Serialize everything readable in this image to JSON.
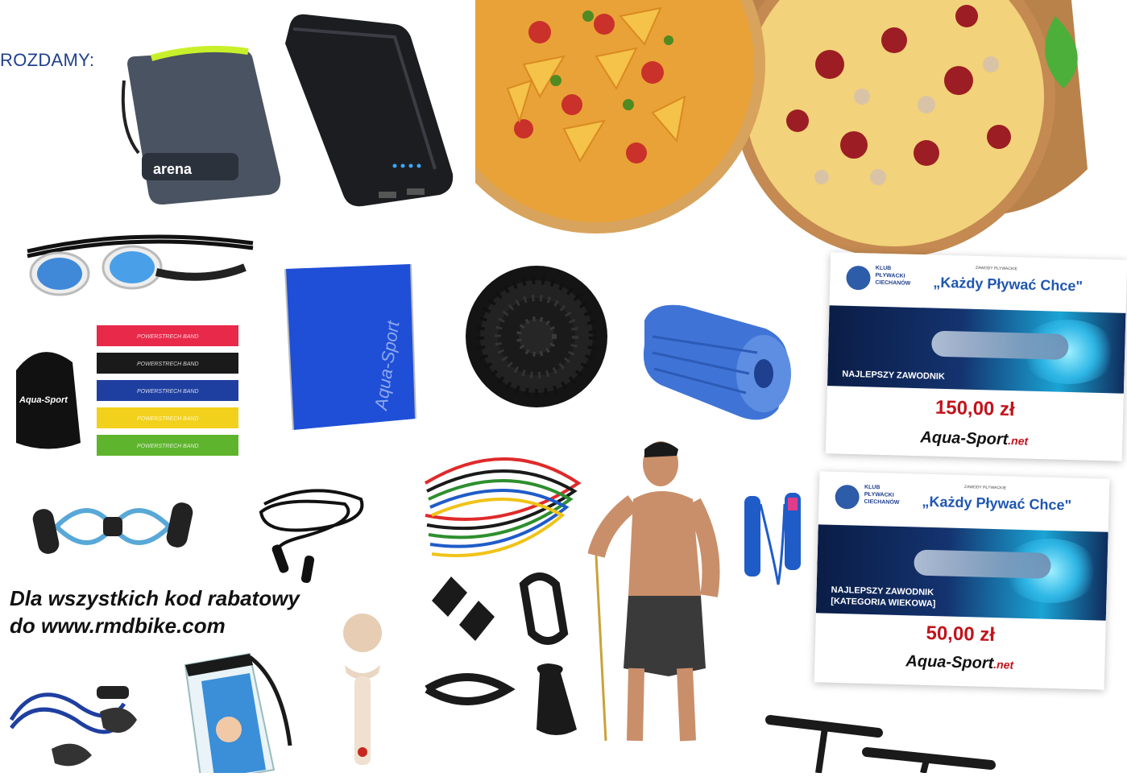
{
  "heading": "ROZDAMY:",
  "promo": {
    "line1": "Dla wszystkich kod rabatowy",
    "line2": "do www.rmdbike.com"
  },
  "prize_cards": [
    {
      "club": "KLUB\nPŁYWACKI\nCIECHANÓW",
      "event_small": "ZAWODY PŁYWACKIE",
      "event_title": "„Każdy Pływać Chce\"",
      "category": "NAJLEPSZY ZAWODNIK",
      "amount": "150,00 zł",
      "brand": "Aqua-Sport",
      "brand_suffix": ".net"
    },
    {
      "club": "KLUB\nPŁYWACKI\nCIECHANÓW",
      "event_small": "ZAWODY PŁYWACKIE",
      "event_title": "„Każdy Pływać Chce\"",
      "category": "NAJLEPSZY ZAWODNIK\n[KATEGORIA WIEKOWA]",
      "amount": "50,00 zł",
      "brand": "Aqua-Sport",
      "brand_suffix": ".net"
    }
  ],
  "product_labels": {
    "bag_logo": "arena",
    "sack_logo": "Aqua-Sport",
    "pouch_logo": "Aqua-Sport",
    "band_label": "POWERSTRECH BAND"
  },
  "colors": {
    "heading": "#1f3f8f",
    "price": "#c0141c",
    "band_red": "#e8294a",
    "band_black": "#1a1a1a",
    "band_blue": "#1f3fa0",
    "band_yellow": "#f2d11c",
    "band_green": "#5fb42e"
  }
}
